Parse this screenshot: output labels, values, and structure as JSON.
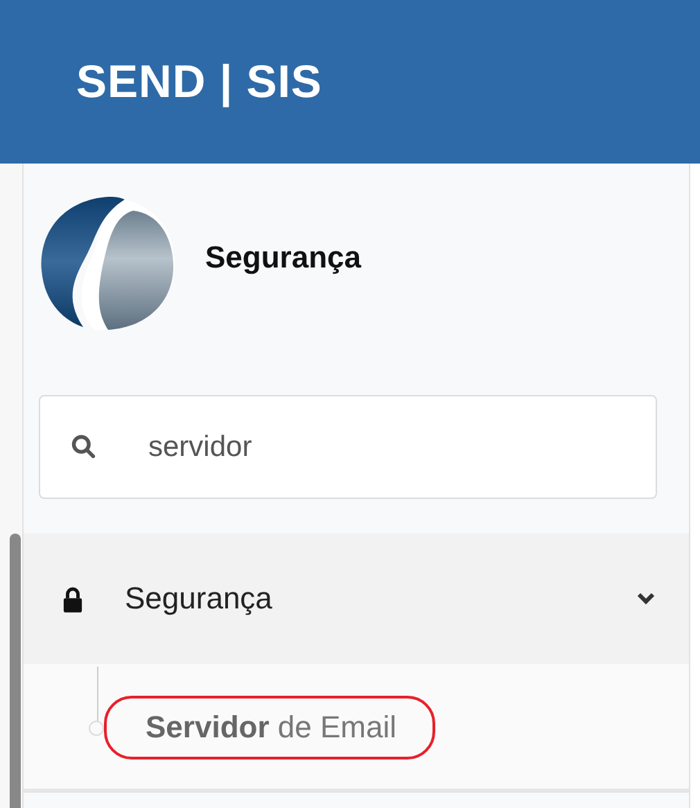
{
  "header": {
    "title": "SEND | SIS"
  },
  "profile": {
    "name": "Segurança"
  },
  "search": {
    "value": "servidor"
  },
  "menu": [
    {
      "label": "Segurança",
      "expanded": true,
      "children": [
        {
          "label": "**Servidor** de Email",
          "highlighted": true
        }
      ]
    }
  ]
}
